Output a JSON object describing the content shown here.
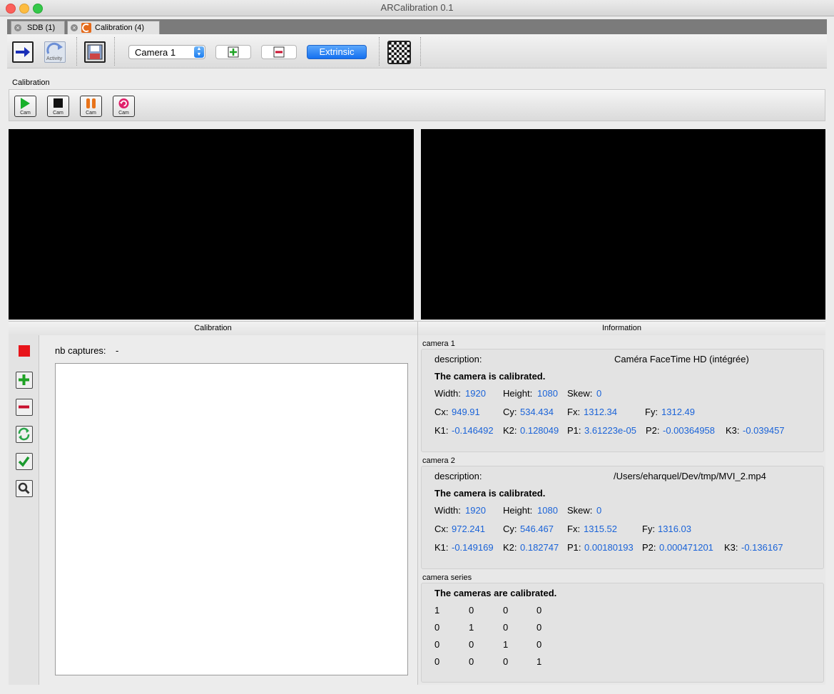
{
  "window": {
    "title": "ARCalibration 0.1"
  },
  "tabs": [
    {
      "label": "SDB (1)"
    },
    {
      "label": "Calibration (4)"
    }
  ],
  "toolbar": {
    "camera_select_value": "Camera 1",
    "extrinsic_label": "Extrinsic",
    "activity_label": "Activity"
  },
  "calibration_toolbar": {
    "group_label": "Calibration",
    "cam_label": "Cam"
  },
  "calibration_panel": {
    "header": "Calibration",
    "nb_captures_label": "nb captures:",
    "nb_captures_value": "-"
  },
  "information_panel": {
    "header": "Information",
    "field_labels": {
      "description": "description:",
      "width": "Width:",
      "height": "Height:",
      "skew": "Skew:",
      "cx": "Cx:",
      "cy": "Cy:",
      "fx": "Fx:",
      "fy": "Fy:",
      "k1": "K1:",
      "k2": "K2:",
      "p1": "P1:",
      "p2": "P2:",
      "k3": "K3:"
    },
    "camera1": {
      "title": "camera 1",
      "description": "Caméra FaceTime HD (intégrée)",
      "status": "The camera is calibrated.",
      "width": "1920",
      "height": "1080",
      "skew": "0",
      "cx": "949.91",
      "cy": "534.434",
      "fx": "1312.34",
      "fy": "1312.49",
      "k1": "-0.146492",
      "k2": "0.128049",
      "p1": "3.61223e-05",
      "p2": "-0.00364958",
      "k3": "-0.039457"
    },
    "camera2": {
      "title": "camera 2",
      "description": "/Users/eharquel/Dev/tmp/MVI_2.mp4",
      "status": "The camera is calibrated.",
      "width": "1920",
      "height": "1080",
      "skew": "0",
      "cx": "972.241",
      "cy": "546.467",
      "fx": "1315.52",
      "fy": "1316.03",
      "k1": "-0.149169",
      "k2": "0.182747",
      "p1": "0.00180193",
      "p2": "0.000471201",
      "k3": "-0.136167"
    },
    "series": {
      "title": "camera series",
      "status": "The cameras are calibrated.",
      "matrix": [
        [
          "1",
          "0",
          "0",
          "0"
        ],
        [
          "0",
          "1",
          "0",
          "0"
        ],
        [
          "0",
          "0",
          "1",
          "0"
        ],
        [
          "0",
          "0",
          "0",
          "1"
        ]
      ]
    }
  },
  "colors": {
    "value_blue": "#1a63d8",
    "extrinsic_blue": "#1470f0",
    "record_red": "#e8141a",
    "add_green": "#1fa224",
    "remove_red": "#c8102e"
  },
  "icons": [
    "arrow-right-icon",
    "activity-icon",
    "save-icon",
    "add-icon",
    "remove-icon",
    "checkerboard-icon",
    "play-icon",
    "stop-icon",
    "pause-icon",
    "restart-icon",
    "record-icon",
    "refresh-icon",
    "check-icon",
    "search-icon"
  ]
}
